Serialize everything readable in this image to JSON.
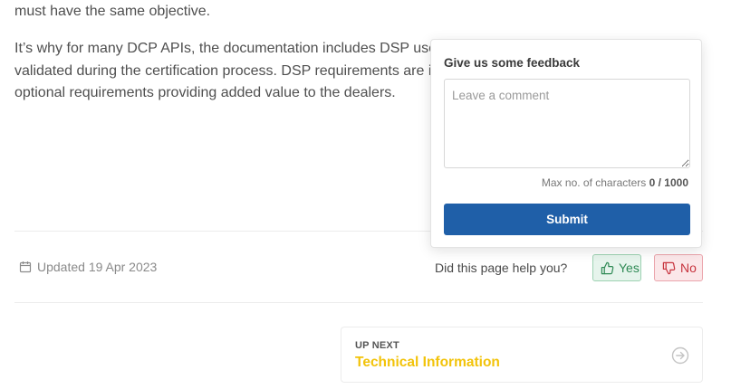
{
  "content": {
    "line_1": "must have the same objective.",
    "para_2_lines": [
      "It’s why for many DCP APIs, the documentation includes DSP user",
      "validated during the certification process. DSP requirements are id",
      "optional requirements providing added value to the dealers."
    ]
  },
  "footer": {
    "updated": "Updated 19 Apr 2023",
    "help_question": "Did this page help you?",
    "yes_label": "Yes",
    "no_label": "No"
  },
  "feedback": {
    "title": "Give us some feedback",
    "placeholder": "Leave a comment",
    "comment_value": "",
    "max_label": "Max no. of characters",
    "count": "0 / 1000",
    "submit_label": "Submit"
  },
  "up_next": {
    "kicker": "UP NEXT",
    "title": "Technical Information"
  },
  "colors": {
    "accent": "#1f5fa8",
    "up_next_title": "#f2c30a",
    "yes": "#2f8a55",
    "no": "#c7333d"
  },
  "icons": {
    "updated": "calendar-icon",
    "yes": "thumbs-up-icon",
    "no": "thumbs-down-icon",
    "up_next": "arrow-right-circle-icon"
  }
}
